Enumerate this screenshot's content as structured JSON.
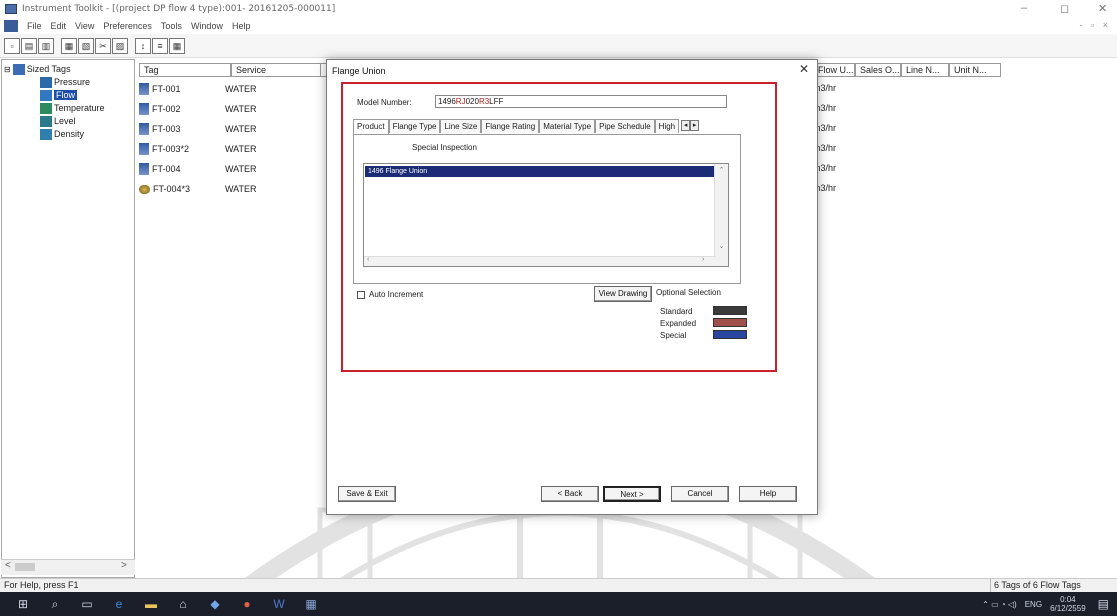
{
  "window": {
    "title": "Instrument Toolkit - [(project DP flow  4 type):001- 20161205-000011]",
    "min": "–",
    "max": "◻",
    "close": "✕",
    "mdi_controls": "- ▫ ×"
  },
  "menu": [
    "File",
    "Edit",
    "View",
    "Preferences",
    "Tools",
    "Window",
    "Help"
  ],
  "toolbar": {
    "icons": [
      "new-icon",
      "open-icon",
      "print-icon",
      "save-icon",
      "copy-icon",
      "cut-icon",
      "paste-icon",
      "sort-icon",
      "filter-icon",
      "grid-icon"
    ]
  },
  "tree": {
    "root": "Sized Tags",
    "expander": "⊟",
    "items": [
      "Pressure",
      "Flow",
      "Temperature",
      "Level",
      "Density"
    ],
    "selected": "Flow"
  },
  "list": {
    "headers": {
      "tag": "Tag",
      "service": "Service",
      "flow_unit": "Flow U...",
      "sales_order": "Sales O...",
      "line_no": "Line N...",
      "unit_no": "Unit N..."
    },
    "rows": [
      {
        "tag": "FT-001",
        "service": "WATER",
        "unit": "m3/hr"
      },
      {
        "tag": "FT-002",
        "service": "WATER",
        "unit": "m3/hr"
      },
      {
        "tag": "FT-003",
        "service": "WATER",
        "unit": "m3/hr"
      },
      {
        "tag": "FT-003*2",
        "service": "WATER",
        "unit": "m3/hr"
      },
      {
        "tag": "FT-004",
        "service": "WATER",
        "unit": "m3/hr"
      },
      {
        "tag": "FT-004*3",
        "service": "WATER",
        "unit": "m3/hr"
      }
    ]
  },
  "dialog": {
    "title": "Flange Union",
    "close": "✕",
    "model_label": "Model Number:",
    "model_parts": [
      "1496",
      "RJ",
      "020",
      "R3",
      "LFF"
    ],
    "tabs": [
      "Product",
      "Flange Type",
      "Line Size",
      "Flange Rating",
      "Material Type",
      "Pipe Schedule",
      "High"
    ],
    "tab_left": "◂",
    "tab_right": "▸",
    "sub_header": "Special Inspection",
    "selected_item": "1496     Flange Union",
    "auto_increment": "Auto Increment",
    "view_drawing": "View Drawing",
    "optional_selection": "Optional Selection",
    "legend": [
      {
        "label": "Standard",
        "color": "#3a3a3a"
      },
      {
        "label": "Expanded",
        "color": "#a0504a"
      },
      {
        "label": "Special",
        "color": "#2846a0"
      }
    ],
    "buttons": {
      "save_exit": "Save & Exit",
      "back": "< Back",
      "next": "Next >",
      "cancel": "Cancel",
      "help": "Help"
    }
  },
  "status": {
    "left": "For Help, press F1",
    "right": "6 Tags of 6 Flow Tags"
  },
  "taskbar": {
    "lang": "ENG",
    "time": "0:04",
    "date": "6/12/2559"
  }
}
